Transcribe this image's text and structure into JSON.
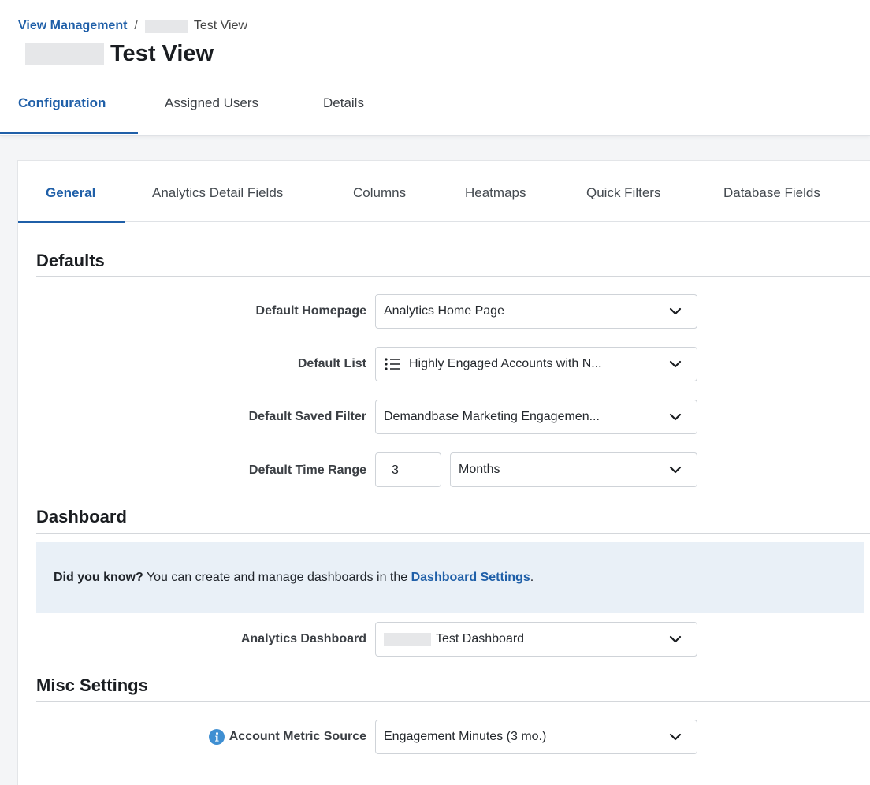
{
  "breadcrumb": {
    "parent": "View Management",
    "separator": "/",
    "current": "Test View"
  },
  "page_title": "Test View",
  "top_tabs": [
    {
      "label": "Configuration",
      "active": true
    },
    {
      "label": "Assigned Users",
      "active": false
    },
    {
      "label": "Details",
      "active": false
    }
  ],
  "inner_tabs": [
    {
      "label": "General",
      "active": true
    },
    {
      "label": "Analytics Detail Fields",
      "active": false
    },
    {
      "label": "Columns",
      "active": false
    },
    {
      "label": "Heatmaps",
      "active": false
    },
    {
      "label": "Quick Filters",
      "active": false
    },
    {
      "label": "Database Fields",
      "active": false
    }
  ],
  "defaults": {
    "heading": "Defaults",
    "homepage": {
      "label": "Default Homepage",
      "value": "Analytics Home Page",
      "icon": "chevron-down-icon"
    },
    "list": {
      "label": "Default List",
      "value": "Highly Engaged Accounts with N...",
      "icon": "list-icon"
    },
    "saved_filter": {
      "label": "Default Saved Filter",
      "value": "Demandbase Marketing Engagemen..."
    },
    "time_range": {
      "label": "Default Time Range",
      "amount": "3",
      "unit": "Months"
    }
  },
  "dashboard": {
    "heading": "Dashboard",
    "banner": {
      "lead": "Did you know?",
      "text": " You can create and manage dashboards in the ",
      "link": "Dashboard Settings",
      "tail": "."
    },
    "analytics_dashboard": {
      "label": "Analytics Dashboard",
      "value": "Test Dashboard"
    }
  },
  "misc": {
    "heading": "Misc Settings",
    "metric_source": {
      "label": "Account Metric Source",
      "value": "Engagement Minutes (3 mo.)",
      "icon": "info-icon"
    }
  },
  "colors": {
    "accent": "#1f5fa8",
    "banner_bg": "#e9f0f7",
    "info_icon": "#3f8fd2"
  }
}
